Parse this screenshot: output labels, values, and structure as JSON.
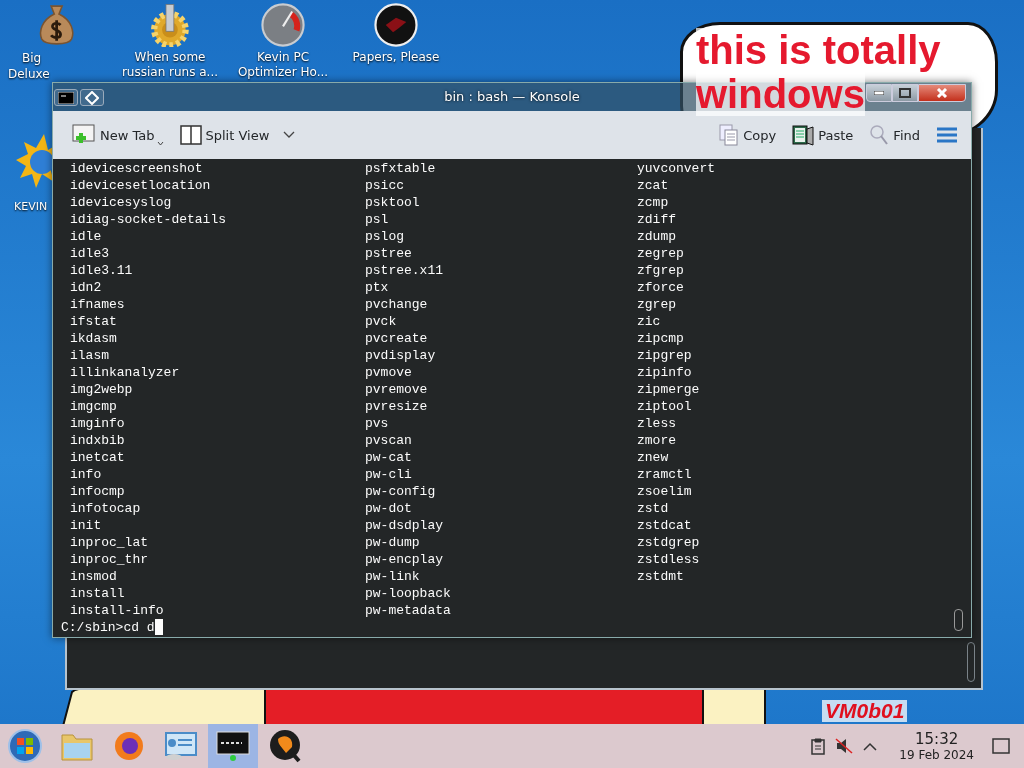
{
  "desktop_icons": [
    {
      "kind": "money-bag",
      "label_lines": [
        "Big",
        "Deluxe"
      ]
    },
    {
      "kind": "gear",
      "label_lines": [
        "When some",
        "russian runs a..."
      ]
    },
    {
      "kind": "gauge",
      "label_lines": [
        "Kevin PC",
        "Optimizer Ho..."
      ]
    },
    {
      "kind": "dark-orb",
      "label_lines": [
        "Papers, Please"
      ]
    },
    {
      "kind": "sun-globe",
      "label_lines": [
        "KEVIN"
      ]
    }
  ],
  "wallpaper": {
    "bubble_lines": [
      "this is totally",
      "windows"
    ],
    "corner_text": "VM0b01"
  },
  "window": {
    "title": "bin : bash — Konsole",
    "toolbar_left": [
      {
        "kind": "new-tab",
        "label": "New Tab"
      },
      {
        "kind": "split-view",
        "label": "Split View"
      }
    ],
    "toolbar_right": [
      {
        "kind": "copy",
        "label": "Copy"
      },
      {
        "kind": "paste",
        "label": "Paste"
      },
      {
        "kind": "find",
        "label": "Find"
      }
    ]
  },
  "terminal": {
    "columns": [
      [
        "idevicescreenshot",
        "idevicesetlocation",
        "idevicesyslog",
        "idiag-socket-details",
        "idle",
        "idle3",
        "idle3.11",
        "idn2",
        "ifnames",
        "ifstat",
        "ikdasm",
        "ilasm",
        "illinkanalyzer",
        "img2webp",
        "imgcmp",
        "imginfo",
        "indxbib",
        "inetcat",
        "info",
        "infocmp",
        "infotocap",
        "init",
        "inproc_lat",
        "inproc_thr",
        "insmod",
        "install",
        "install-info"
      ],
      [
        "psfxtable",
        "psicc",
        "psktool",
        "psl",
        "pslog",
        "pstree",
        "pstree.x11",
        "ptx",
        "pvchange",
        "pvck",
        "pvcreate",
        "pvdisplay",
        "pvmove",
        "pvremove",
        "pvresize",
        "pvs",
        "pvscan",
        "pw-cat",
        "pw-cli",
        "pw-config",
        "pw-dot",
        "pw-dsdplay",
        "pw-dump",
        "pw-encplay",
        "pw-link",
        "pw-loopback",
        "pw-metadata"
      ],
      [
        "yuvconvert",
        "zcat",
        "zcmp",
        "zdiff",
        "zdump",
        "zegrep",
        "zfgrep",
        "zforce",
        "zgrep",
        "zic",
        "zipcmp",
        "zipgrep",
        "zipinfo",
        "zipmerge",
        "ziptool",
        "zless",
        "zmore",
        "znew",
        "zramctl",
        "zsoelim",
        "zstd",
        "zstdcat",
        "zstdgrep",
        "zstdless",
        "zstdmt"
      ]
    ],
    "prompt": "C:/sbin>cd d"
  },
  "taskbar": {
    "apps": [
      {
        "kind": "start",
        "selected": false
      },
      {
        "kind": "files",
        "selected": false
      },
      {
        "kind": "browser",
        "selected": false
      },
      {
        "kind": "control-panel",
        "selected": false
      },
      {
        "kind": "terminal",
        "selected": true
      },
      {
        "kind": "torrent",
        "selected": false
      }
    ],
    "time": "15:32",
    "date": "19 Feb 2024"
  }
}
